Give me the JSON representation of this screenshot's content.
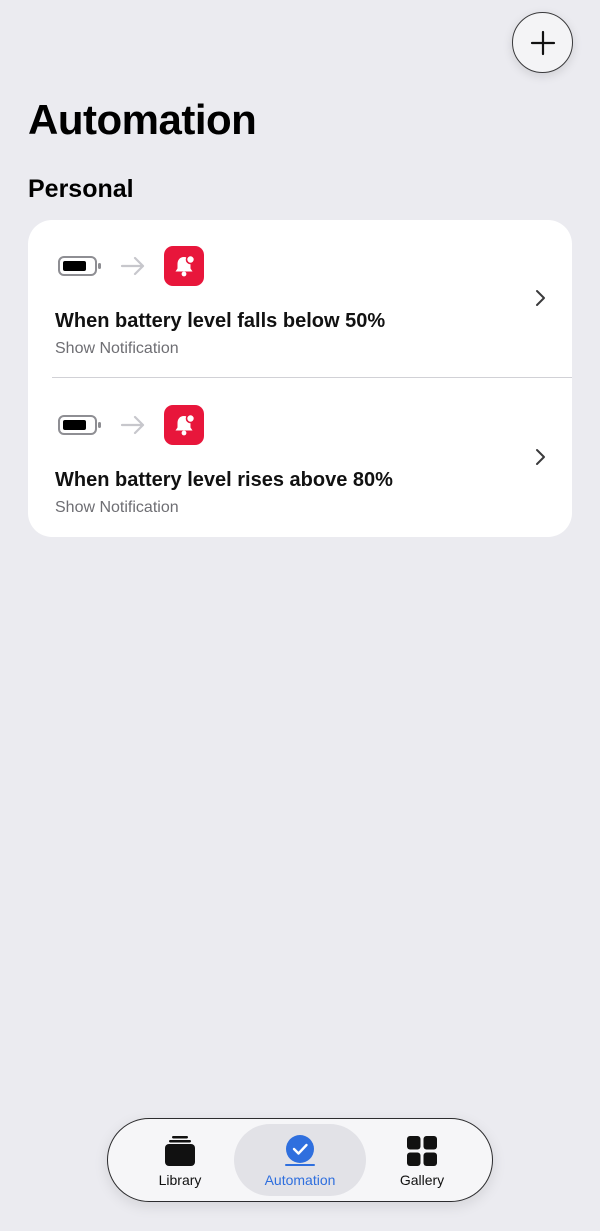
{
  "page_title": "Automation",
  "section_title": "Personal",
  "automations": [
    {
      "title": "When battery level falls below 50%",
      "subtitle": "Show Notification",
      "trigger_icon": "battery-icon",
      "action_icon": "notification-bell-icon"
    },
    {
      "title": "When battery level rises above 80%",
      "subtitle": "Show Notification",
      "trigger_icon": "battery-icon",
      "action_icon": "notification-bell-icon"
    }
  ],
  "tabs": [
    {
      "label": "Library",
      "icon": "library-stack-icon",
      "selected": false
    },
    {
      "label": "Automation",
      "icon": "automation-check-icon",
      "selected": true
    },
    {
      "label": "Gallery",
      "icon": "gallery-grid-icon",
      "selected": false
    }
  ],
  "colors": {
    "background": "#ebebf0",
    "accent": "#2f6fde",
    "notification_red": "#e8163b"
  }
}
